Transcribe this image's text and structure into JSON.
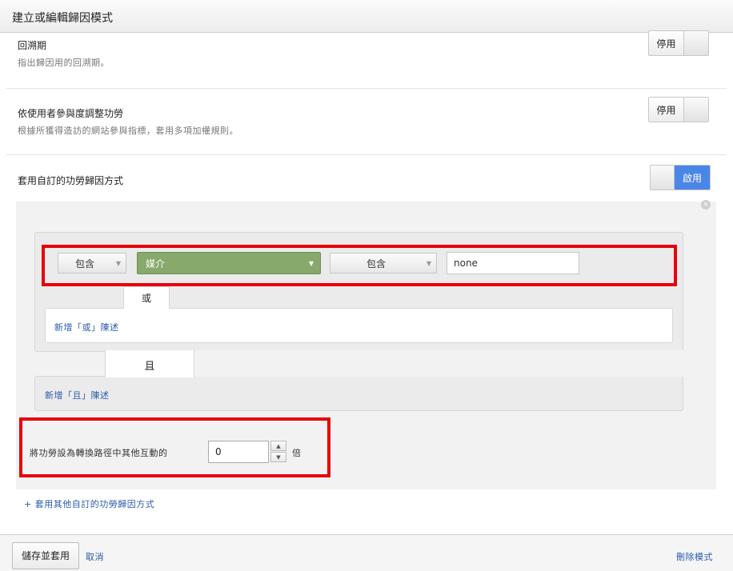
{
  "header": {
    "title": "建立或編輯歸因模式"
  },
  "lookback": {
    "title": "回溯期",
    "description": "指出歸因用的回溯期。",
    "toggle_label": "停用"
  },
  "engagement": {
    "title": "依使用者參與度調整功勞",
    "description": "根據所獲得造訪的網站參與指標，套用多項加權規則。",
    "toggle_label": "停用"
  },
  "custom_credit": {
    "title": "套用自訂的功勞歸因方式",
    "toggle_label": "啟用",
    "state": "on"
  },
  "rule": {
    "close_icon": "close-icon",
    "condition": {
      "include_1": "包含",
      "dimension": "媒介",
      "include_2": "包含",
      "value": "none"
    },
    "or_label": "或",
    "add_or_link": "新增「或」陳述",
    "and_label": "且",
    "add_and_link": "新增「且」陳述",
    "multiplier_label": "將功勞設為轉換路徑中其他互動的",
    "multiplier_value": "0",
    "multiplier_unit": "倍"
  },
  "add_rule_link": "+ 套用其他自訂的功勞歸因方式",
  "footer": {
    "save": "儲存並套用",
    "cancel": "取消",
    "delete": "刪除模式"
  },
  "colors": {
    "highlight": "#e8000b",
    "dimension_green": "#87a96b",
    "toggle_on": "#4a86e8",
    "link": "#2a5ba8"
  }
}
